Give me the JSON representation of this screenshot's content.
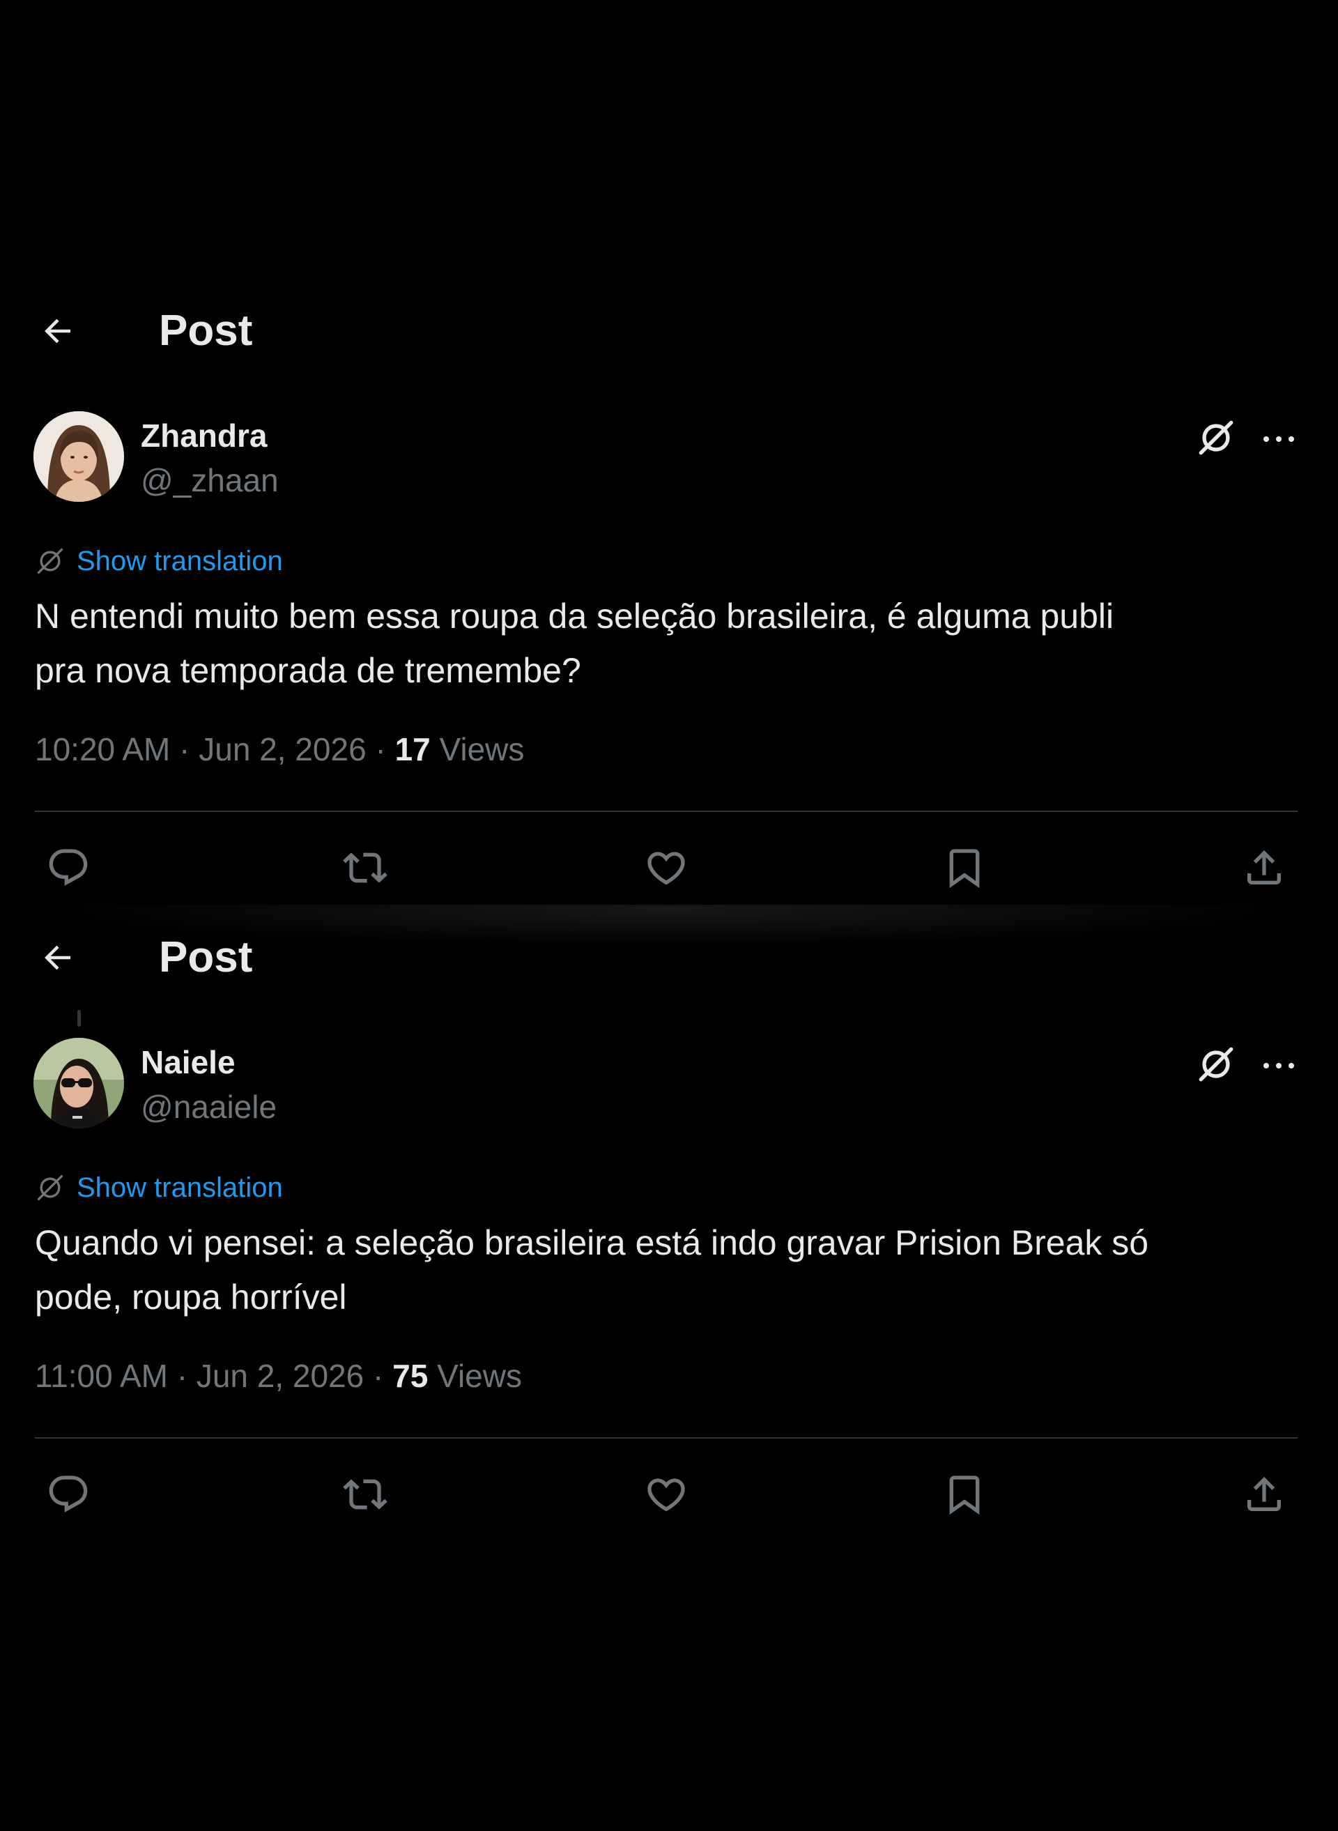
{
  "colors": {
    "background": "#000000",
    "primary_text": "#e7e9ea",
    "secondary_text": "#71767b",
    "link": "#1d9bf0",
    "divider": "#2f3336"
  },
  "posts": [
    {
      "header": {
        "back_icon": "arrow-left-icon",
        "title": "Post"
      },
      "author": {
        "name": "Zhandra",
        "handle": "@_zhaan",
        "avatar": "avatar-photo"
      },
      "translation": {
        "icon": "grok-translate-icon",
        "label": "Show translation"
      },
      "text": "N entendi muito bem essa roupa da seleção brasileira, é alguma publi\npra nova temporada de tremembe?",
      "meta": {
        "time": "10:20 AM",
        "date": "Jun 2, 2026",
        "views_count": "17",
        "views_label": "Views"
      },
      "actions": [
        "reply-icon",
        "retweet-icon",
        "like-icon",
        "bookmark-icon",
        "share-icon"
      ]
    },
    {
      "header": {
        "back_icon": "arrow-left-icon",
        "title": "Post"
      },
      "author": {
        "name": "Naiele",
        "handle": "@naaiele",
        "avatar": "avatar-photo"
      },
      "translation": {
        "icon": "grok-translate-icon",
        "label": "Show translation"
      },
      "text": "Quando vi pensei: a seleção brasileira está indo gravar Prision Break só\npode, roupa horrível",
      "meta": {
        "time": "11:00 AM",
        "date": "Jun 2, 2026",
        "views_count": "75",
        "views_label": "Views"
      },
      "actions": [
        "reply-icon",
        "retweet-icon",
        "like-icon",
        "bookmark-icon",
        "share-icon"
      ]
    }
  ]
}
